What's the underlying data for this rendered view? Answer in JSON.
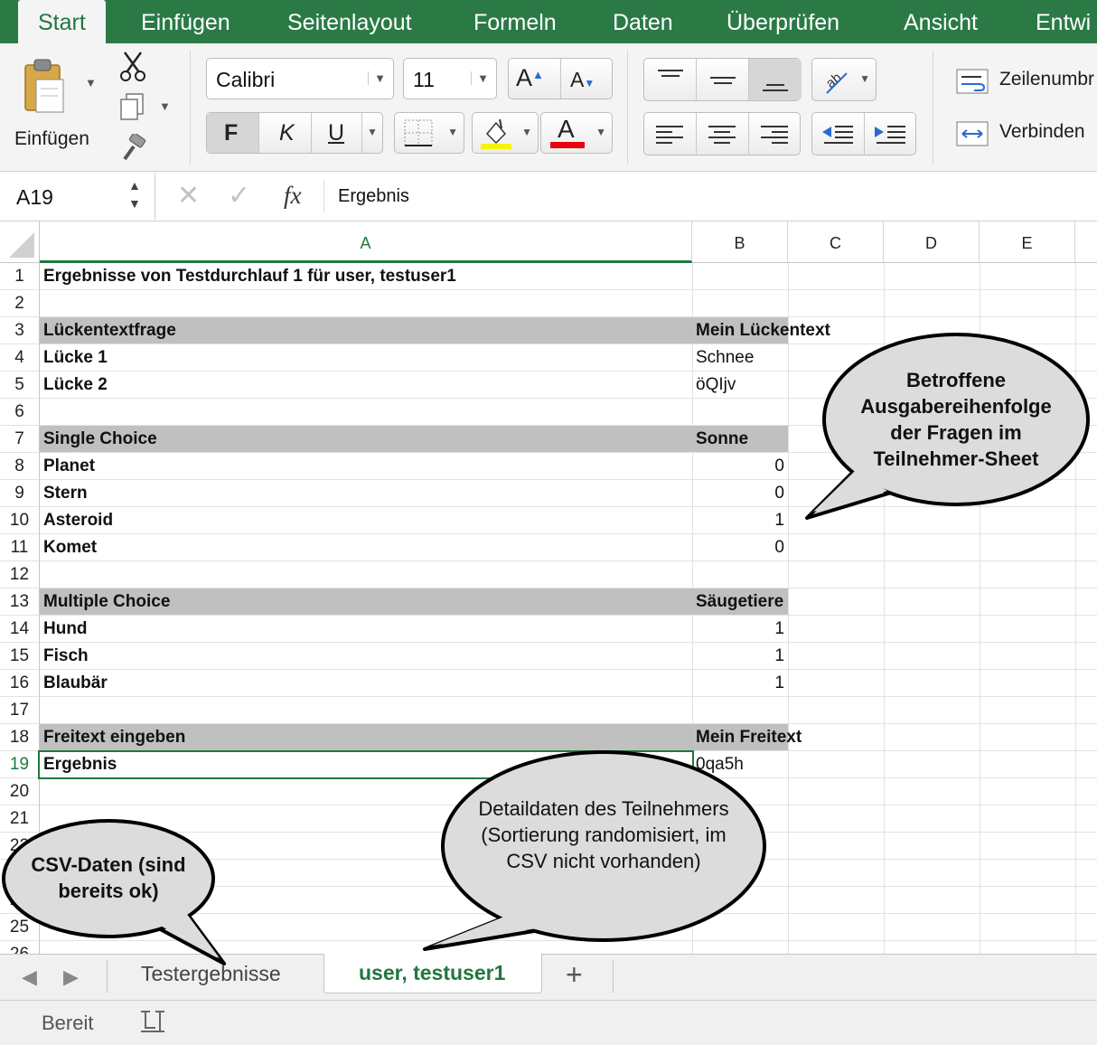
{
  "ribbon_tabs": [
    "Start",
    "Einfügen",
    "Seitenlayout",
    "Formeln",
    "Daten",
    "Überprüfen",
    "Ansicht",
    "Entwi"
  ],
  "ribbon": {
    "paste_label": "Einfügen",
    "font_name": "Calibri",
    "font_size": "11",
    "bold_label": "F",
    "italic_label": "K",
    "underline_label": "U",
    "wrap_text_label": "Zeilenumbr",
    "merge_label": "Verbinden"
  },
  "formula_bar": {
    "name_box": "A19",
    "fx": "fx",
    "content": "Ergebnis"
  },
  "columns": [
    "A",
    "B",
    "C",
    "D",
    "E"
  ],
  "rows": [
    "1",
    "2",
    "3",
    "4",
    "5",
    "6",
    "7",
    "8",
    "9",
    "10",
    "11",
    "12",
    "13",
    "14",
    "15",
    "16",
    "17",
    "18",
    "19",
    "20",
    "21",
    "22",
    "23",
    "24",
    "25",
    "26"
  ],
  "active_row": "19",
  "cells": {
    "a1": "Ergebnisse von Testdurchlauf 1 für user, testuser1",
    "a3": "Lückentextfrage",
    "b3": "Mein Lückentext",
    "a4": "Lücke 1",
    "b4": "Schnee",
    "a5": "Lücke 2",
    "b5": "öQIjv",
    "a7": "Single Choice",
    "b7": "Sonne",
    "a8": "Planet",
    "b8": "0",
    "a9": "Stern",
    "b9": "0",
    "a10": "Asteroid",
    "b10": "1",
    "a11": "Komet",
    "b11": "0",
    "a13": "Multiple Choice",
    "b13": "Säugetiere",
    "a14": "Hund",
    "b14": "1",
    "a15": "Fisch",
    "b15": "1",
    "a16": "Blaubär",
    "b16": "1",
    "a18": "Freitext eingeben",
    "b18": "Mein Freitext",
    "a19": "Ergebnis",
    "b19": "0qa5h"
  },
  "sheet_tabs": {
    "tab1": "Testergebnisse",
    "tab2": "user, testuser1",
    "add": "+"
  },
  "status": "Bereit",
  "callouts": {
    "c1": "Betroffene Ausgabereihenfolge der Fragen im Teilnehmer-Sheet",
    "c2": "Detaildaten des Teilnehmers (Sortierung randomisiert, im CSV nicht vorhanden)",
    "c3": "CSV-Daten (sind bereits ok)"
  },
  "colors": {
    "ribbon_green": "#2b7a46",
    "header_band": "#c0c0c0",
    "selection": "#21773f",
    "callout_fill": "#dcdcdc"
  }
}
